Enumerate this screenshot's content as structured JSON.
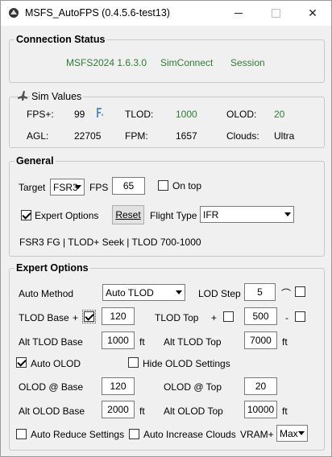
{
  "window": {
    "title": "MSFS_AutoFPS (0.4.5.6-test13)"
  },
  "connection": {
    "title": "Connection Status",
    "sim": "MSFS2024 1.6.3.0",
    "simconnect": "SimConnect",
    "session": "Session"
  },
  "sim_values": {
    "title": "Sim Values",
    "fps_label": "FPS+:",
    "fps_value": "99",
    "tlod_label": "TLOD:",
    "tlod_value": "1000",
    "olod_label": "OLOD:",
    "olod_value": "20",
    "agl_label": "AGL:",
    "agl_value": "22705",
    "fpm_label": "FPM:",
    "fpm_value": "1657",
    "clouds_label": "Clouds:",
    "clouds_value": "Ultra"
  },
  "general": {
    "title": "General",
    "target_label": "Target",
    "target_value": "FSR3",
    "fps_label": "FPS",
    "fps_value": "65",
    "on_top_label": "On top",
    "expert_label": "Expert Options",
    "reset_label": "Reset",
    "flight_type_label": "Flight Type",
    "flight_type_value": "IFR",
    "status_line": "FSR3 FG | TLOD+ Seek | TLOD 700-1000"
  },
  "expert": {
    "title": "Expert Options",
    "auto_method_label": "Auto Method",
    "auto_method_value": "Auto TLOD",
    "lod_step_label": "LOD Step",
    "lod_step_value": "5",
    "lod_step_suffix": "⌒",
    "tlod_base_label": "TLOD Base",
    "plus": "+",
    "minus": "-",
    "tlod_base_value": "120",
    "tlod_top_label": "TLOD Top",
    "tlod_top_value": "500",
    "alt_tlod_base_label": "Alt TLOD Base",
    "alt_tlod_base_value": "1000",
    "ft": "ft",
    "alt_tlod_top_label": "Alt TLOD Top",
    "alt_tlod_top_value": "7000",
    "auto_olod_label": "Auto OLOD",
    "hide_olod_label": "Hide OLOD Settings",
    "olod_base_label": "OLOD @ Base",
    "olod_base_value": "120",
    "olod_top_label": "OLOD @ Top",
    "olod_top_value": "20",
    "alt_olod_base_label": "Alt OLOD Base",
    "alt_olod_base_value": "2000",
    "alt_olod_top_label": "Alt OLOD Top",
    "alt_olod_top_value": "10000",
    "auto_reduce_label": "Auto Reduce Settings",
    "auto_increase_label": "Auto Increase Clouds",
    "vram_label": "VRAM+",
    "vram_value": "Max"
  }
}
